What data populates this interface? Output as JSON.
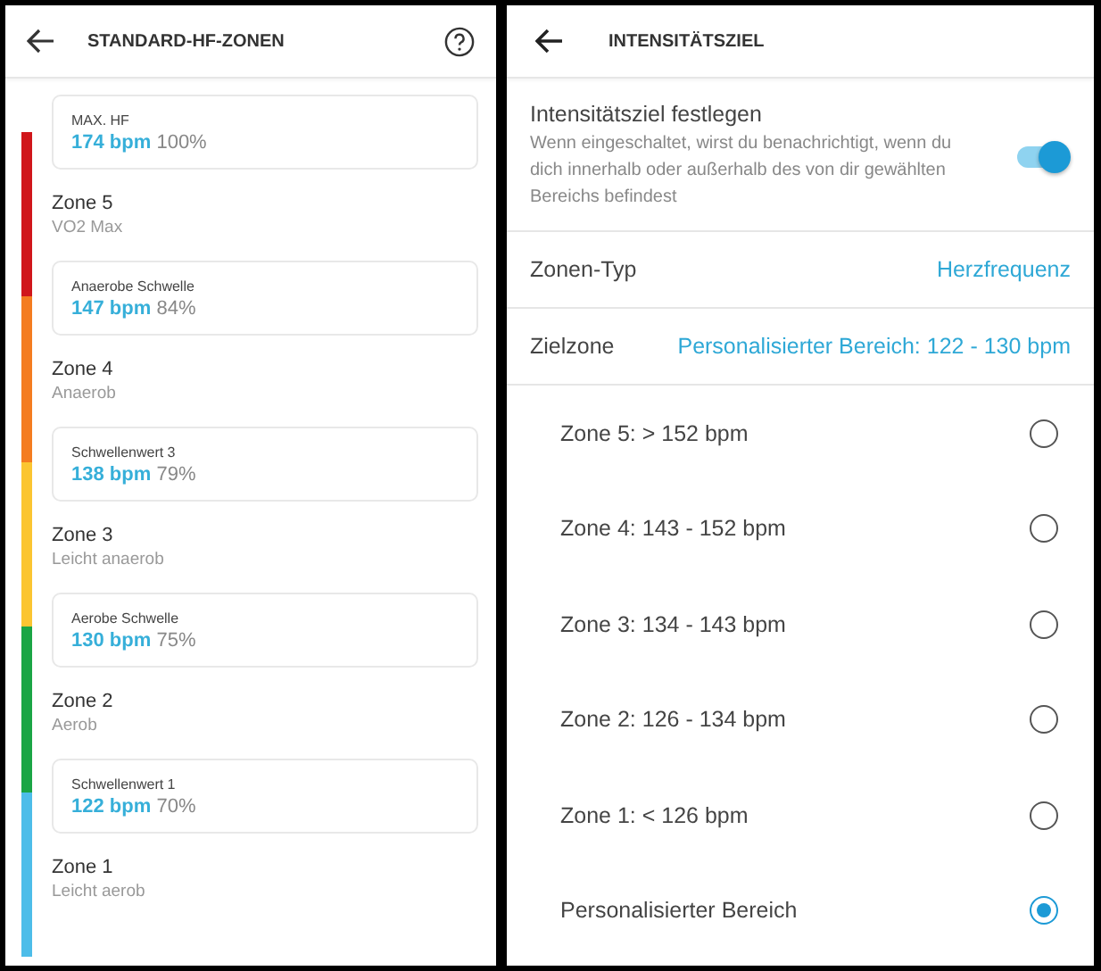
{
  "left_screen": {
    "title": "STANDARD-HF-ZONEN",
    "max": {
      "label": "MAX. HF",
      "bpm": "174 bpm",
      "percent": "100%"
    },
    "zones": [
      {
        "name": "Zone 5",
        "description": "VO2 Max",
        "color": "#d0161b",
        "threshold": {
          "label": "Anaerobe Schwelle",
          "bpm": "147 bpm",
          "percent": "84%"
        }
      },
      {
        "name": "Zone 4",
        "description": "Anaerob",
        "color": "#f47c20",
        "threshold": {
          "label": "Schwellenwert 3",
          "bpm": "138 bpm",
          "percent": "79%"
        }
      },
      {
        "name": "Zone 3",
        "description": "Leicht anaerob",
        "color": "#fbc531",
        "threshold": {
          "label": "Aerobe Schwelle",
          "bpm": "130 bpm",
          "percent": "75%"
        }
      },
      {
        "name": "Zone 2",
        "description": "Aerob",
        "color": "#1aa545",
        "threshold": {
          "label": "Schwellenwert 1",
          "bpm": "122 bpm",
          "percent": "70%"
        }
      },
      {
        "name": "Zone 1",
        "description": "Leicht aerob",
        "color": "#4dbde9"
      }
    ]
  },
  "right_screen": {
    "title": "INTENSITÄTSZIEL",
    "toggle": {
      "label": "Intensitätsziel festlegen",
      "description": "Wenn eingeschaltet, wirst du benachrichtigt, wenn du dich innerhalb oder außerhalb des von dir gewählten Bereichs befindest",
      "on": true
    },
    "settings": [
      {
        "label": "Zonen-Typ",
        "value": "Herzfrequenz"
      },
      {
        "label": "Zielzone",
        "value": "Personalisierter Bereich: 122 - 130 bpm"
      }
    ],
    "options": [
      {
        "label": "Zone 5: > 152 bpm",
        "selected": false
      },
      {
        "label": "Zone 4: 143 - 152 bpm",
        "selected": false
      },
      {
        "label": "Zone 3: 134 - 143 bpm",
        "selected": false
      },
      {
        "label": "Zone 2: 126 - 134 bpm",
        "selected": false
      },
      {
        "label": "Zone 1: < 126 bpm",
        "selected": false
      },
      {
        "label": "Personalisierter Bereich",
        "selected": true
      }
    ]
  }
}
